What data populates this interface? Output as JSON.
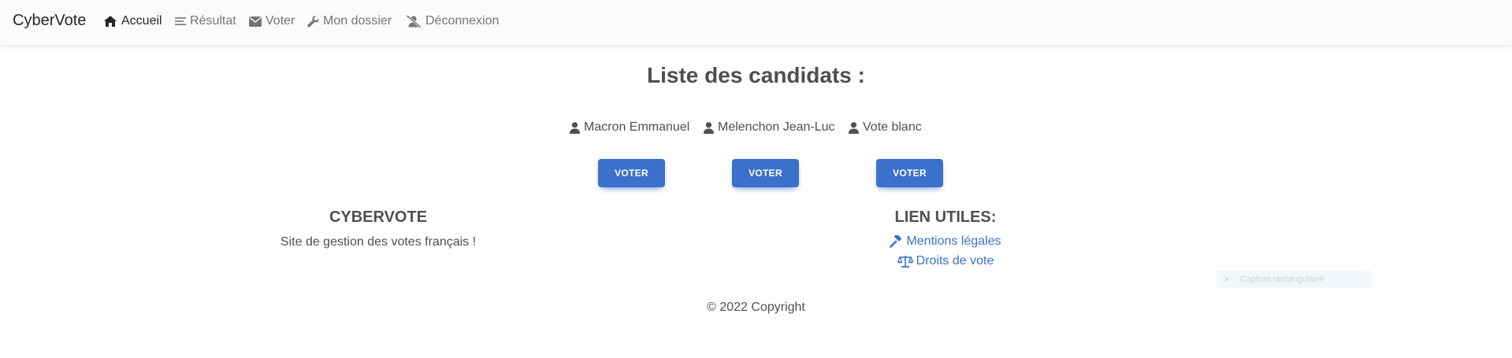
{
  "navbar": {
    "brand": "CyberVote",
    "items": [
      {
        "label": "Accueil",
        "icon": "home-icon",
        "active": true
      },
      {
        "label": "Résultat",
        "icon": "list-icon",
        "active": false
      },
      {
        "label": "Voter",
        "icon": "envelope-icon",
        "active": false
      },
      {
        "label": "Mon dossier",
        "icon": "wrench-icon",
        "active": false
      },
      {
        "label": "Déconnexion",
        "icon": "user-slash-icon",
        "active": false
      }
    ]
  },
  "main": {
    "title": "Liste des candidats :",
    "candidates": [
      {
        "name": "Macron Emmanuel",
        "icon": "user-icon",
        "button_label": "VOTER"
      },
      {
        "name": "Melenchon Jean-Luc",
        "icon": "user-icon",
        "button_label": "VOTER"
      },
      {
        "name": "Vote blanc",
        "icon": "user-icon",
        "button_label": "VOTER"
      }
    ]
  },
  "footer": {
    "about": {
      "heading": "CYBERVOTE",
      "text": "Site de gestion des votes français !"
    },
    "links": {
      "heading": "LIEN UTILES:",
      "items": [
        {
          "label": "Mentions légales",
          "icon": "gavel-icon"
        },
        {
          "label": "Droits de vote",
          "icon": "scale-icon"
        }
      ]
    },
    "copyright": "© 2022 Copyright"
  },
  "overlay": {
    "label": "Capture rectangulaire"
  },
  "colors": {
    "accent": "#3b71ca",
    "text": "#4f4f4f",
    "nav_bg": "#fbfbfb"
  }
}
